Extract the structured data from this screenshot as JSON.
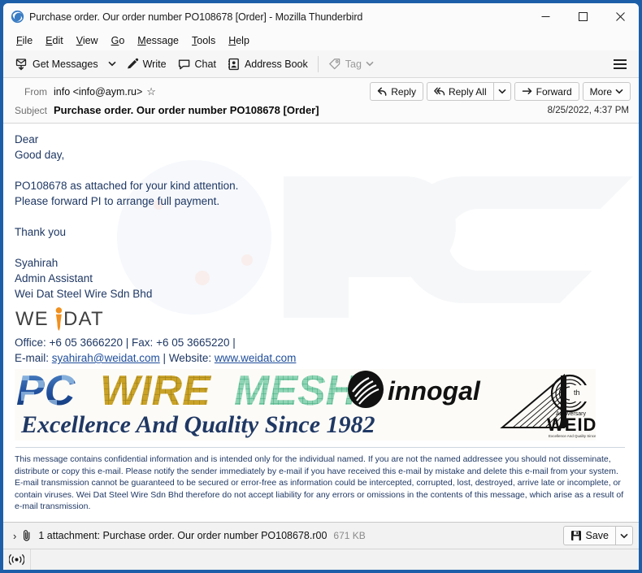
{
  "window": {
    "title": "Purchase order. Our order number PO108678 [Order] - Mozilla Thunderbird",
    "app_icon": "thunderbird-icon",
    "minimize_label": "–",
    "maximize_label": "☐",
    "close_label": "✕",
    "frame_color": "#1c5fa8"
  },
  "menubar": {
    "items": [
      {
        "label": "File",
        "accel": "F"
      },
      {
        "label": "Edit",
        "accel": "E"
      },
      {
        "label": "View",
        "accel": "V"
      },
      {
        "label": "Go",
        "accel": "G"
      },
      {
        "label": "Message",
        "accel": "M"
      },
      {
        "label": "Tools",
        "accel": "T"
      },
      {
        "label": "Help",
        "accel": "H"
      }
    ]
  },
  "toolbar": {
    "get_messages_label": "Get Messages",
    "write_label": "Write",
    "chat_label": "Chat",
    "address_book_label": "Address Book",
    "tag_label": "Tag",
    "app_menu_name": "hamburger-menu"
  },
  "message_header": {
    "from_label": "From",
    "from_value": "info <info@aym.ru>",
    "star_glyph": "☆",
    "subject_label": "Subject",
    "subject_value": "Purchase order. Our order number PO108678 [Order]",
    "date": "8/25/2022, 4:37 PM",
    "buttons": {
      "reply": "Reply",
      "reply_all": "Reply All",
      "forward": "Forward",
      "more": "More"
    }
  },
  "body": {
    "greeting_line1": "Dear",
    "greeting_line2": "Good day,",
    "para1_line1": "PO108678 as attached for your kind attention.",
    "para1_line2": "Please forward PI to arrange full payment.",
    "thanks": "Thank you",
    "sig_name": "Syahirah",
    "sig_title": "Admin Assistant",
    "sig_company": "Wei Dat Steel Wire Sdn Bhd",
    "logo_text_left": "WE",
    "logo_text_right": "DAT",
    "logo_accent_color": "#f0901e",
    "contact_office_label": "Office:",
    "contact_office_value": "+6 05 3666220",
    "contact_fax_label": "Fax:",
    "contact_fax_value": "+6 05 3665220",
    "contact_email_label": "E-mail:",
    "contact_email_value": "syahirah@weidat.com",
    "contact_website_label": "Website:",
    "contact_website_value": "www.weidat.com",
    "text_color": "#1f3864",
    "link_color": "#1f4e9c",
    "watermark_text": "PC"
  },
  "banner": {
    "word_pc": "PC",
    "word_wire": "WIRE",
    "word_mesh": "MESH",
    "innogal_text": "innogal",
    "tagline": "Excellence And Quality Since 1982",
    "anniv_number": "4",
    "anniv_th": "th",
    "anniv_word": "Anniversary",
    "anniv_brand": "WEIDAT",
    "anniv_sub": "Excellence And Quality Since 1982",
    "pc_color": "#1f4e9c",
    "wire_color": "#c9a227",
    "mesh_color": "#5bbf8f",
    "tagline_color": "#1f3864"
  },
  "disclaimer": {
    "text": "This message contains confidential information and is intended only for the individual named. If you are not the named addressee you should not disseminate, distribute or copy this e-mail. Please notify the sender immediately by e-mail if you have received this e-mail by mistake and delete this e-mail from your system. E-mail transmission cannot be guaranteed to be secured or error-free as information could be intercepted, corrupted, lost, destroyed, arrive late or incomplete, or contain viruses. Wei Dat Steel Wire Sdn Bhd therefore do not accept liability for any errors or omissions in the contents of this message, which arise as a result of e-mail transmission."
  },
  "attachment_bar": {
    "expand_glyph": "›",
    "summary": "1 attachment: Purchase order. Our order number PO108678.r00",
    "size": "671 KB",
    "save_label": "Save"
  },
  "statusbar": {
    "icon_name": "online-status-icon"
  }
}
